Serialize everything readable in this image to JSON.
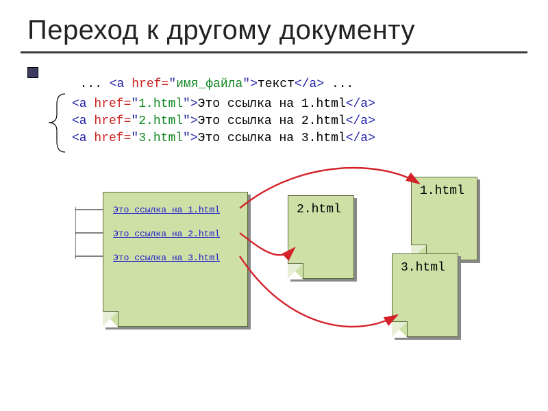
{
  "title": "Переход к другому документу",
  "syntax": {
    "pre": "... ",
    "open1": "<a ",
    "attr": "href=",
    "q1": "\"",
    "val": "имя_файла",
    "q2": "\"",
    "close1": ">",
    "text": "текст",
    "close2": "</a>",
    "post": " ..."
  },
  "examples": [
    {
      "href": "1.html",
      "text": "Это ссылка на 1.html"
    },
    {
      "href": "2.html",
      "text": "Это ссылка на 2.html"
    },
    {
      "href": "3.html",
      "text": "Это ссылка на 3.html"
    }
  ],
  "main_doc_links": [
    "Это ссылка на 1.html",
    "Это ссылка на 2.html",
    "Это ссылка на 3.html"
  ],
  "targets": {
    "doc1": "1.html",
    "doc2": "2.html",
    "doc3": "3.html"
  },
  "colors": {
    "arrow": "#d4222a",
    "doc_fill": "#cfe0a7",
    "link": "#1a1acc"
  }
}
